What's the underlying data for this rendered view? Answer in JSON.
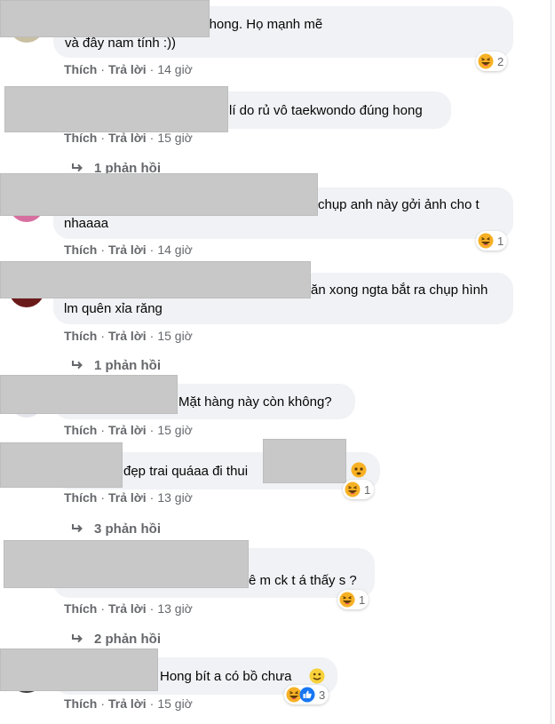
{
  "actions": {
    "like": "Thích",
    "reply": "Trả lời",
    "sep": "·"
  },
  "comments": [
    {
      "text": "Mình thích con trai tên Phong. Họ mạnh mẽ\nvà đây nam tính :))",
      "time": "14 giờ",
      "reaction": {
        "icons": [
          "haha-icon"
        ],
        "count": "2"
      }
    },
    {
      "text": "lí do rủ vô taekwondo đúng hong",
      "time": "15 giờ",
      "replies": "1 phản hồi"
    },
    {
      "text": "chụp anh này gởi ảnh cho t\nnhaaaa",
      "time": "14 giờ",
      "reaction": {
        "icons": [
          "haha-icon"
        ],
        "count": "1"
      }
    },
    {
      "text": "ăn xong ngta bắt ra chụp hình\nlm quên xỉa răng",
      "time": "15 giờ",
      "replies": "1 phản hồi"
    },
    {
      "text": "Mặt hàng này còn không?",
      "time": "15 giờ"
    },
    {
      "text": "đẹp trai quáaa đi thui",
      "time": "13 giờ",
      "reaction": {
        "icons": [
          "haha-icon"
        ],
        "count": "1"
      },
      "replies": "3 phản hồi"
    },
    {
      "text": "ê m ck t á thấy s ?",
      "time": "13 giờ",
      "reaction": {
        "icons": [
          "haha-icon"
        ],
        "count": "1"
      },
      "replies": "2 phản hồi"
    },
    {
      "text": "Hong bít a có bồ chưa",
      "time": "15 giờ",
      "reaction": {
        "icons": [
          "haha-icon",
          "like-icon"
        ],
        "count": "3"
      }
    }
  ],
  "colors": {
    "bubble": "#f0f2f5",
    "meta": "#65676b",
    "text": "#050505",
    "redaction": "#c8c8c8",
    "haha": "#f7b125",
    "like": "#1877f2"
  }
}
